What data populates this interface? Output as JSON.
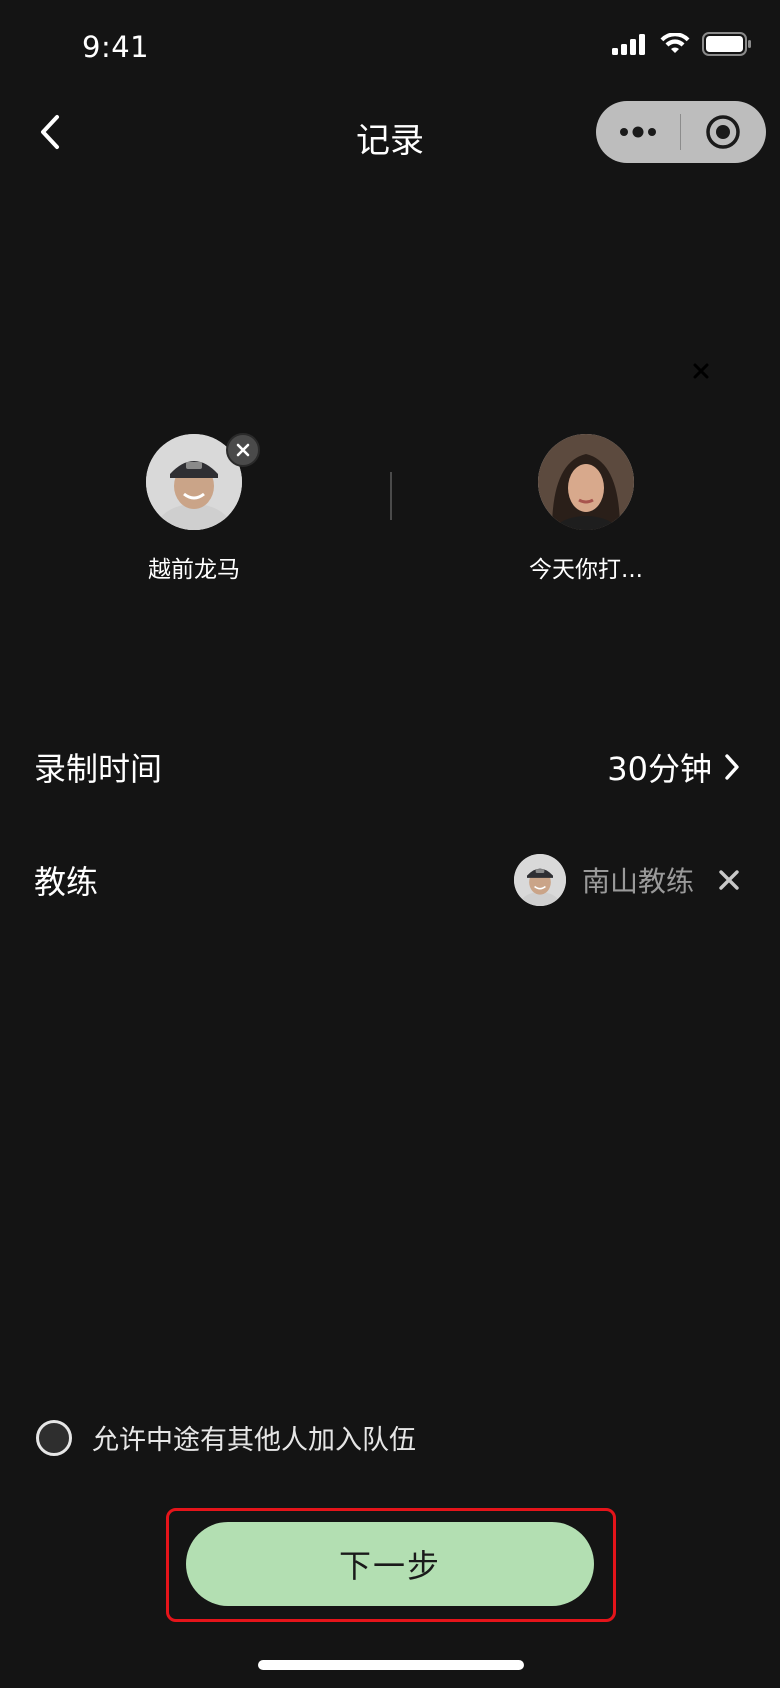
{
  "status_bar": {
    "time": "9:41"
  },
  "nav": {
    "title": "记录"
  },
  "players": [
    {
      "name": "越前龙马"
    },
    {
      "name": "今天你打..."
    }
  ],
  "settings": {
    "duration_label": "录制时间",
    "duration_value": "30分钟",
    "coach_label": "教练",
    "coach_name": "南山教练"
  },
  "allow_join": {
    "label": "允许中途有其他人加入队伍",
    "checked": false
  },
  "next_button": {
    "label": "下一步"
  },
  "colors": {
    "background": "#141414",
    "accent_button": "#b3dfb2",
    "highlight_border": "#e5141a",
    "muted_text": "#9a9a9a"
  },
  "icons": {
    "back": "chevron-left-icon",
    "more": "more-dots-icon",
    "mini_close": "target-circle-icon",
    "remove": "close-icon",
    "chevron": "chevron-right-icon"
  }
}
